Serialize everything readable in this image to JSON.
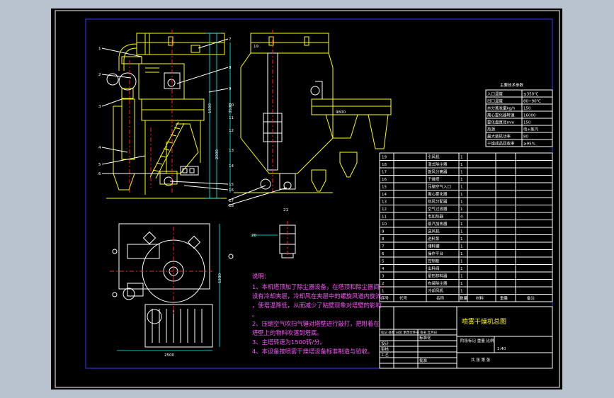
{
  "drawing": {
    "title": "喷雾干燥机总图",
    "params_table": {
      "header": "主要技术参数",
      "rows": [
        {
          "name": "入口温度",
          "value": "≤350℃"
        },
        {
          "name": "出口温度",
          "value": "80~90℃"
        },
        {
          "name": "水分蒸发量kg/h",
          "value": "150"
        },
        {
          "name": "离心雾化器转速",
          "value": "16000"
        },
        {
          "name": "雾化盘直径mm",
          "value": "150"
        },
        {
          "name": "热源",
          "value": "电+蒸汽"
        },
        {
          "name": "最大装机功率",
          "value": "80"
        },
        {
          "name": "干燥成品回收率",
          "value": "≥95%"
        }
      ]
    },
    "parts": [
      {
        "no": "19",
        "name": "引风机",
        "qty": "1"
      },
      {
        "no": "18",
        "name": "湿式除尘器",
        "qty": "1"
      },
      {
        "no": "17",
        "name": "旋风分离器",
        "qty": "1"
      },
      {
        "no": "16",
        "name": "干燥塔",
        "qty": "1"
      },
      {
        "no": "15",
        "name": "压缩空气入口",
        "qty": "1"
      },
      {
        "no": "14",
        "name": "离心雾化器",
        "qty": "1"
      },
      {
        "no": "13",
        "name": "热风分配器",
        "qty": "1"
      },
      {
        "no": "12",
        "name": "空气过滤器",
        "qty": "1"
      },
      {
        "no": "11",
        "name": "电加热器",
        "qty": "4"
      },
      {
        "no": "10",
        "name": "蒸汽加热器",
        "qty": "1"
      },
      {
        "no": "9",
        "name": "送风机",
        "qty": "1"
      },
      {
        "no": "8",
        "name": "进料泵",
        "qty": "1"
      },
      {
        "no": "7",
        "name": "储料罐",
        "qty": "1"
      },
      {
        "no": "6",
        "name": "操作平台",
        "qty": "1"
      },
      {
        "no": "5",
        "name": "控制柜",
        "qty": "1"
      },
      {
        "no": "4",
        "name": "出料阀",
        "qty": "1"
      },
      {
        "no": "3",
        "name": "星形卸料器",
        "qty": "1"
      },
      {
        "no": "2",
        "name": "布袋除尘器",
        "qty": "1"
      },
      {
        "no": "1",
        "name": "冷却风机",
        "qty": "1"
      }
    ],
    "part_table_header": {
      "no": "序号",
      "code": "代号",
      "name": "名称",
      "qty": "数量",
      "material": "材料",
      "weight": "重量",
      "remark": "备注"
    },
    "title_block": {
      "revision": "标记 处数 分区 更改文件号 签名 年月日",
      "design": "设计",
      "standard": "标准化",
      "review": "审核",
      "process": "工艺",
      "approve": "批准",
      "stage": "阶段标记 重量 比例",
      "scale": "1:40",
      "sheet": "共 张  第 张"
    },
    "notes_title": "说明：",
    "notes": [
      "1、本机塔顶加了除尘器设备，在塔顶和除尘器间设有冷却夹层，冷却风在夹层中的螺旋风道内旋流，使塔温降低，从而减少了粘壁现象对塔壁的影响。",
      "2、压缩空气吹扫气锤对塔壁进行敲打，把附着在塔壁上的物料吹落到塔底。",
      "3、主塔转速为1500转/分。",
      "4、本设备按喷雾干燥塔设备标准制造与验收。"
    ],
    "balloons": [
      "1",
      "2",
      "3",
      "4",
      "5",
      "6",
      "7",
      "8",
      "9",
      "10",
      "11",
      "12",
      "13",
      "14",
      "15",
      "16",
      "17",
      "18",
      "19",
      "20",
      "21"
    ],
    "dims": [
      "1500",
      "2000",
      "3500",
      "9800",
      "2500",
      "1200",
      "4600",
      "600",
      "4200",
      "2300",
      "1800",
      "3000"
    ]
  }
}
